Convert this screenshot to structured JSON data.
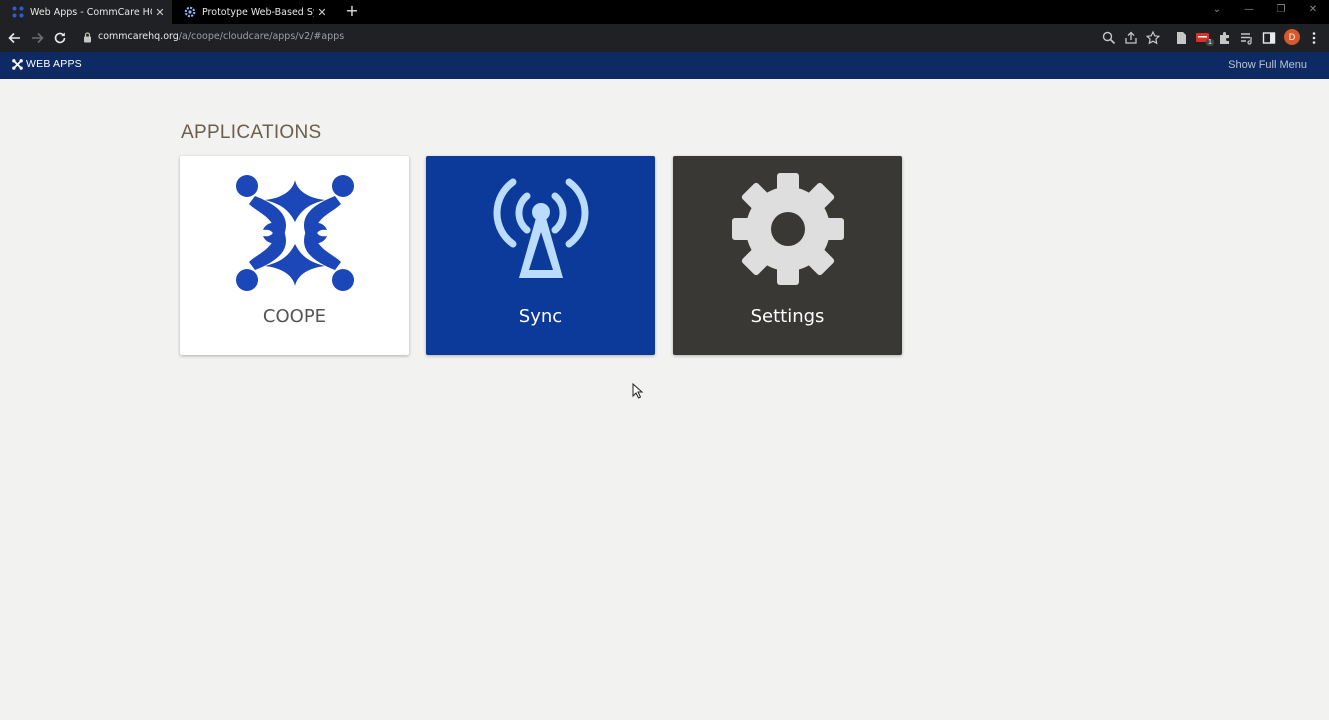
{
  "browser": {
    "tabs": [
      {
        "title": "Web Apps - CommCare HQ",
        "active": true,
        "icon": "commcare-icon"
      },
      {
        "title": "Prototype Web-Based System: C",
        "active": false,
        "icon": "gear-icon"
      }
    ],
    "url_host": "commcarehq.org",
    "url_path": "/a/coope/cloudcare/apps/v2/#apps",
    "profile_initial": "D",
    "extension_badge": "1"
  },
  "nav": {
    "brand": "WEB APPS",
    "full_menu": "Show Full Menu"
  },
  "main": {
    "section_title": "APPLICATIONS",
    "tiles": [
      {
        "label": "COOPE",
        "icon": "coope-logo-icon",
        "color": "#ffffff"
      },
      {
        "label": "Sync",
        "icon": "antenna-icon",
        "color": "#0b3a9a"
      },
      {
        "label": "Settings",
        "icon": "gear-icon",
        "color": "#3a3835"
      }
    ]
  }
}
